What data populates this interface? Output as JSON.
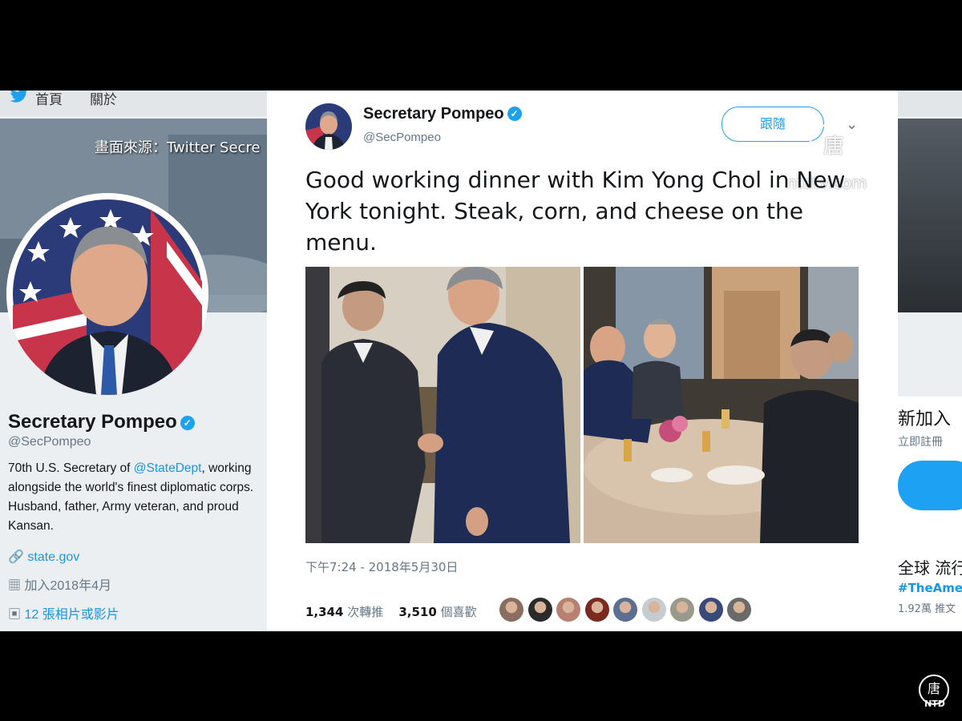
{
  "nav": {
    "home": "首頁",
    "about": "關於"
  },
  "caption": "畫面來源：Twitter Secre",
  "profile": {
    "name": "Secretary Pompeo",
    "handle": "@SecPompeo",
    "bio_1": "70th U.S. Secretary of ",
    "bio_link": "@StateDept",
    "bio_2": ", working alongside the world's finest diplomatic corps. Husband, father, Army veteran, and proud Kansan.",
    "website": "state.gov",
    "joined": "加入2018年4月",
    "photos": "12 張相片或影片"
  },
  "right_panel": {
    "new_title": "新加入",
    "signup": "立即註冊",
    "trends": "全球 流行",
    "trend1": "#TheAmer",
    "trend1_count": "1.92萬 推文"
  },
  "tweet": {
    "name": "Secretary Pompeo",
    "handle": "@SecPompeo",
    "verified_glyph": "✓",
    "follow_label": "跟隨",
    "text": "Good working dinner with Kim Yong Chol in New York tonight. Steak, corn, and cheese on the menu.",
    "timestamp": "下午7:24 - 2018年5月30日",
    "retweets_count": "1,344",
    "retweets_label": "次轉推",
    "likes_count": "3,510",
    "likes_label": "個喜歡"
  },
  "watermark": {
    "glyph": "唐",
    "url": "ntdtv.com"
  },
  "ntd_logo": {
    "glyph": "唐",
    "text": "NTD"
  },
  "likers": [
    "#8a6f60",
    "#2b2b2b",
    "#b88070",
    "#7a2a1e",
    "#5c6f90",
    "#c6ccd2",
    "#9a9a8c",
    "#3a4a78",
    "#6a6a6a"
  ],
  "colors": {
    "accent": "#1da1f2",
    "text": "#14171a",
    "muted": "#657786"
  }
}
